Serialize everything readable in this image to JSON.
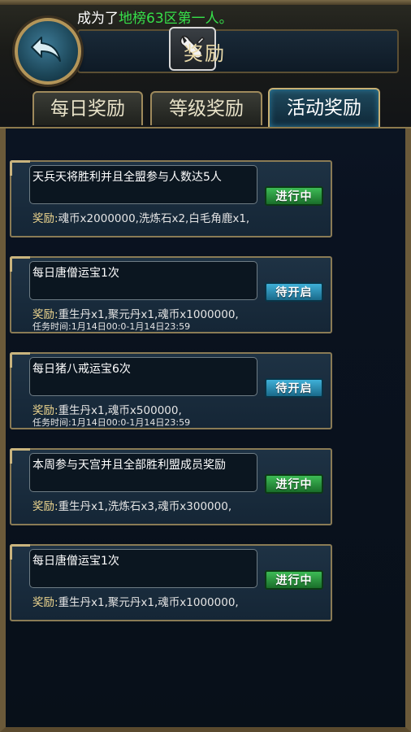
{
  "header": {
    "broadcast_prefix": "成为了",
    "broadcast_highlight": "地榜63区第一人。",
    "title": "奖励",
    "back_icon": "back-arrow-icon",
    "title_icon": "wrench-icon"
  },
  "tabs": [
    {
      "label": "每日奖励",
      "active": false
    },
    {
      "label": "等级奖励",
      "active": false
    },
    {
      "label": "活动奖励",
      "active": true
    }
  ],
  "reward_label": "奖励:",
  "tasks": [
    {
      "name": "天兵天将胜利并且全盟参与人数达5人",
      "reward": "魂币x2000000,洗炼石x2,白毛角鹿x1,",
      "time": "",
      "status": "进行中",
      "status_color": "#2a9a3e"
    },
    {
      "name": "每日唐僧运宝1次",
      "reward": "重生丹x1,聚元丹x1,魂币x1000000,",
      "time": "任务时间:1月14日00:0-1月14日23:59",
      "status": "待开启",
      "status_color": "#2a8fb8"
    },
    {
      "name": "每日猪八戒运宝6次",
      "reward": "重生丹x1,魂币x500000,",
      "time": "任务时间:1月14日00:0-1月14日23:59",
      "status": "待开启",
      "status_color": "#2a8fb8"
    },
    {
      "name": "本周参与天宫并且全部胜利盟成员奖励",
      "reward": "重生丹x1,洗炼石x3,魂币x300000,",
      "time": "",
      "status": "进行中",
      "status_color": "#2a9a3e"
    },
    {
      "name": "每日唐僧运宝1次",
      "reward": "重生丹x1,聚元丹x1,魂币x1000000,",
      "time": "",
      "status": "进行中",
      "status_color": "#2a9a3e"
    }
  ]
}
